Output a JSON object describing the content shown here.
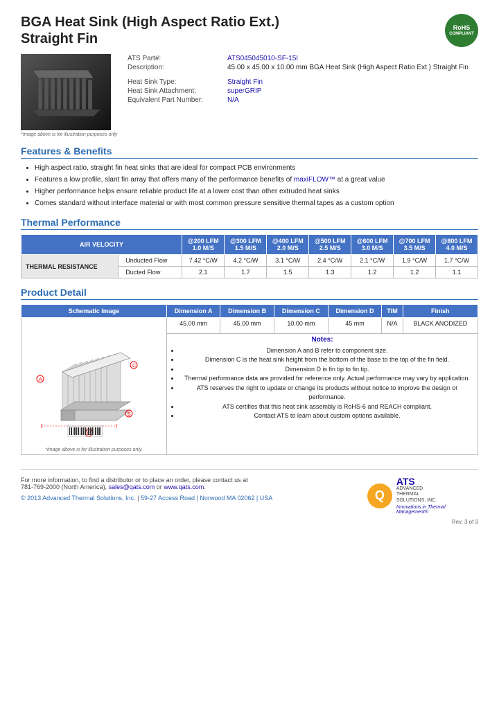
{
  "header": {
    "title_line1": "BGA Heat Sink (High Aspect Ratio Ext.)",
    "title_line2": "Straight Fin",
    "rohs": {
      "line1": "RoHS",
      "line2": "COMPLIANT"
    }
  },
  "product_info": {
    "part_number_label": "ATS Part#:",
    "part_number_value": "ATS045045010-SF-15I",
    "description_label": "Description:",
    "description_value": "45.00 x 45.00 x 10.00 mm BGA Heat Sink (High Aspect Ratio Ext.) Straight Fin",
    "heat_sink_type_label": "Heat Sink Type:",
    "heat_sink_type_value": "Straight Fin",
    "attachment_label": "Heat Sink Attachment:",
    "attachment_value": "superGRIP",
    "equiv_part_label": "Equivalent Part Number:",
    "equiv_part_value": "N/A",
    "image_caption": "*Image above is for illustration purposes only"
  },
  "features": {
    "section_title": "Features & Benefits",
    "items": [
      "High aspect ratio, straight fin heat sinks that are ideal for compact PCB environments",
      "Features a low profile, slant fin array that offers many of the performance benefits of maxiFLOW™ at a great value",
      "Higher performance helps ensure reliable product life at a lower cost than other extruded heat sinks",
      "Comes standard without interface material or with most common pressure sensitive thermal tapes as a custom option"
    ],
    "highlight_text": "maxiFLOW™"
  },
  "thermal_performance": {
    "section_title": "Thermal Performance",
    "table": {
      "col_header_label": "AIR VELOCITY",
      "columns": [
        {
          "label": "@200 LFM",
          "sublabel": "1.0 M/S"
        },
        {
          "label": "@300 LFM",
          "sublabel": "1.5 M/S"
        },
        {
          "label": "@400 LFM",
          "sublabel": "2.0 M/S"
        },
        {
          "label": "@500 LFM",
          "sublabel": "2.5 M/S"
        },
        {
          "label": "@600 LFM",
          "sublabel": "3.0 M/S"
        },
        {
          "label": "@700 LFM",
          "sublabel": "3.5 M/S"
        },
        {
          "label": "@800 LFM",
          "sublabel": "4.0 M/S"
        }
      ],
      "row_group_label": "THERMAL RESISTANCE",
      "rows": [
        {
          "label": "Unducted Flow",
          "values": [
            "7.42 °C/W",
            "4.2 °C/W",
            "3.1 °C/W",
            "2.4 °C/W",
            "2.1 °C/W",
            "1.9 °C/W",
            "1.7 °C/W"
          ]
        },
        {
          "label": "Ducted Flow",
          "values": [
            "2.1",
            "1.7",
            "1.5",
            "1.3",
            "1.2",
            "1.2",
            "1.1"
          ]
        }
      ]
    }
  },
  "product_detail": {
    "section_title": "Product Detail",
    "table": {
      "columns": [
        "Schematic Image",
        "Dimension A",
        "Dimension B",
        "Dimension C",
        "Dimension D",
        "TIM",
        "Finish"
      ],
      "values": {
        "dim_a": "45.00 mm",
        "dim_b": "45.00 mm",
        "dim_c": "10.00 mm",
        "dim_d": "45 mm",
        "tim": "N/A",
        "finish": "BLACK ANODIZED"
      }
    },
    "schematic_caption": "*Image above is for illustration purposes only.",
    "notes_title": "Notes:",
    "notes": [
      "Dimension A and B refer to component size.",
      "Dimension C is the heat sink height from the bottom of the base to the top of the fin field.",
      "Dimension D is fin tip to fin tip.",
      "Thermal performance data are provided for reference only. Actual performance may vary by application.",
      "ATS reserves the right to update or change its products without notice to improve the design or performance.",
      "ATS certifies that this heat sink assembly is RoHS-6 and REACH compliant.",
      "Contact ATS to learn about custom options available."
    ]
  },
  "footer": {
    "contact_text": "For more information, to find a distributor or to place an order, please contact us at",
    "phone": "781-769-2000 (North America),",
    "email": "sales@qats.com",
    "email_join": " or ",
    "website": "www.qats.com",
    "copyright": "© 2013 Advanced Thermal Solutions, Inc.",
    "address": "59-27 Access Road  |  Norwood MA  02062  |  USA",
    "ats_q": "Q",
    "ats_title": "ATS",
    "ats_subtitle_line1": "ADVANCED",
    "ats_subtitle_line2": "THERMAL",
    "ats_subtitle_line3": "SOLUTIONS, INC.",
    "ats_tagline": "Innovations in Thermal Management®",
    "page_number": "Rev. 3 of 3"
  }
}
